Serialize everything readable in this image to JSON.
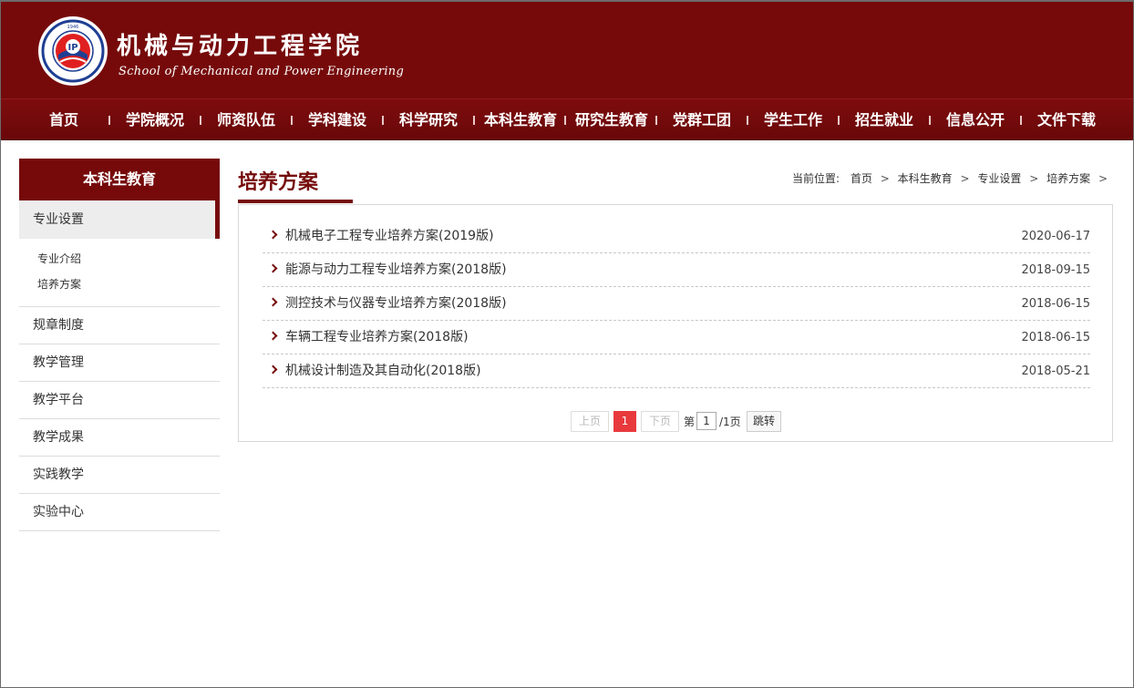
{
  "header": {
    "title_cn": "机械与动力工程学院",
    "title_en": "School of Mechanical and Power Engineering",
    "logo_icon": "college-emblem-icon"
  },
  "nav": {
    "items": [
      {
        "label": "首页"
      },
      {
        "label": "学院概况"
      },
      {
        "label": "师资队伍"
      },
      {
        "label": "学科建设"
      },
      {
        "label": "科学研究"
      },
      {
        "label": "本科生教育"
      },
      {
        "label": "研究生教育"
      },
      {
        "label": "党群工团"
      },
      {
        "label": "学生工作"
      },
      {
        "label": "招生就业"
      },
      {
        "label": "信息公开"
      },
      {
        "label": "文件下载"
      }
    ]
  },
  "sidebar": {
    "title": "本科生教育",
    "active": {
      "label": "专业设置"
    },
    "sub_items": [
      {
        "label": "专业介绍"
      },
      {
        "label": "培养方案"
      }
    ],
    "items": [
      {
        "label": "规章制度"
      },
      {
        "label": "教学管理"
      },
      {
        "label": "教学平台"
      },
      {
        "label": "教学成果"
      },
      {
        "label": "实践教学"
      },
      {
        "label": "实验中心"
      }
    ]
  },
  "main": {
    "title": "培养方案",
    "breadcrumb": {
      "prefix": "当前位置:",
      "items": [
        "首页",
        "本科生教育",
        "专业设置",
        "培养方案"
      ],
      "sep": ">"
    },
    "list": [
      {
        "title": "机械电子工程专业培养方案(2019版)",
        "date": "2020-06-17"
      },
      {
        "title": "能源与动力工程专业培养方案(2018版)",
        "date": "2018-09-15"
      },
      {
        "title": "测控技术与仪器专业培养方案(2018版)",
        "date": "2018-06-15"
      },
      {
        "title": "车辆工程专业培养方案(2018版)",
        "date": "2018-06-15"
      },
      {
        "title": "机械设计制造及其自动化(2018版)",
        "date": "2018-05-21"
      }
    ],
    "pager": {
      "prev": "上页",
      "current": "1",
      "next": "下页",
      "page_prefix": "第",
      "page_value": "1",
      "page_suffix": "/1页",
      "go": "跳转"
    }
  },
  "colors": {
    "brand": "#760a0b",
    "pager_active": "#e8393d"
  }
}
